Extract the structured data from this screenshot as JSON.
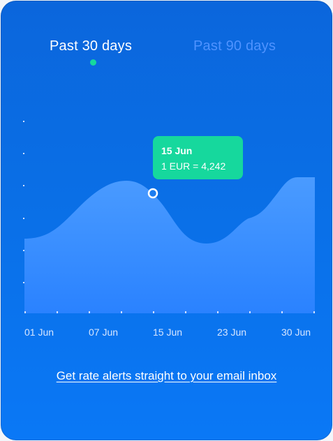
{
  "tabs": [
    {
      "label": "Past 30 days",
      "active": true
    },
    {
      "label": "Past 90 days",
      "active": false
    }
  ],
  "tooltip": {
    "date": "15 Jun",
    "rate": "1 EUR = 4,242"
  },
  "alert_link": "Get rate alerts straight to your email inbox",
  "colors": {
    "background_top": "#0b66dc",
    "background_bottom": "#0a78f6",
    "accent": "#16d89d",
    "area_top": "#4a9bff",
    "area_bottom": "#2a82ff",
    "inactive_tab": "#4f93ff"
  },
  "chart_data": {
    "type": "area",
    "x_tick_labels": [
      "01 Jun",
      "07 Jun",
      "15 Jun",
      "23 Jun",
      "30 Jun"
    ],
    "highlighted_point": {
      "date": "15 Jun",
      "label": "1 EUR = 4,242"
    },
    "y_tick_labels": [],
    "grid": false,
    "legend": "none"
  }
}
